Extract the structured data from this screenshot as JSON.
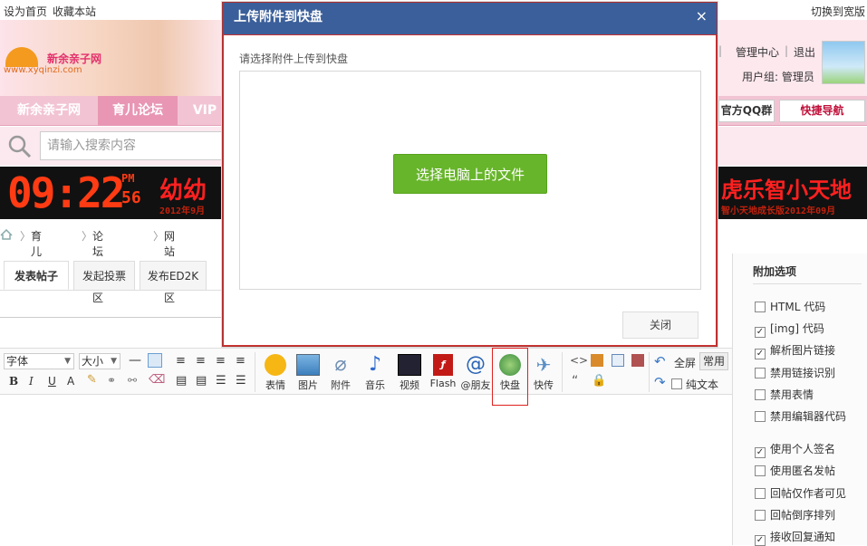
{
  "topbar": {
    "set_home": "设为首页",
    "bookmark": "收藏本站",
    "switch_wide": "切换到宽版"
  },
  "banner": {
    "logo_text": "新余亲子网",
    "logo_url": "www.xyqinzi.com",
    "admin_center": "管理中心",
    "logout": "退出",
    "sep": "|",
    "usergroup": "用户组: 管理员"
  },
  "nav": {
    "tabs": [
      "新余亲子网",
      "育儿论坛",
      "VIP"
    ],
    "qq_group": "官方QQ群",
    "quick_nav": "快捷导航"
  },
  "search": {
    "placeholder": "请输入搜索内容"
  },
  "led": {
    "time": "09:22",
    "ampm": "PM",
    "sec": "56",
    "left_text": "幼幼",
    "right_text": "虎乐智小天地",
    "left_sub": "2012年9月",
    "right_sub": "智小天地成长版2012年09月"
  },
  "breadcrumb": {
    "items": [
      "育儿论坛",
      "论坛讨论区",
      "网站管理区"
    ]
  },
  "post_tabs": [
    "发表帖子",
    "发起投票",
    "发布ED2K"
  ],
  "editor": {
    "font_select": "字体",
    "size_select": "大小",
    "tools": [
      {
        "icon": "smiley-icon",
        "label": "表情"
      },
      {
        "icon": "image-icon",
        "label": "图片"
      },
      {
        "icon": "attachment-icon",
        "label": "附件"
      },
      {
        "icon": "music-icon",
        "label": "音乐"
      },
      {
        "icon": "video-icon",
        "label": "视频"
      },
      {
        "icon": "flash-icon",
        "label": "Flash"
      },
      {
        "icon": "at-icon",
        "label": "@朋友"
      },
      {
        "icon": "kuaipan-icon",
        "label": "快盘"
      },
      {
        "icon": "kuaichuan-icon",
        "label": "快传"
      }
    ],
    "fullscreen": "全屏",
    "common": "常用",
    "plain_text": "纯文本"
  },
  "sidebar": {
    "title": "附加选项",
    "options": [
      {
        "label": "HTML 代码",
        "checked": false
      },
      {
        "label": "[img] 代码",
        "checked": true
      },
      {
        "label": "解析图片链接",
        "checked": true
      },
      {
        "label": "禁用链接识别",
        "checked": false
      },
      {
        "label": "禁用表情",
        "checked": false
      },
      {
        "label": "禁用编辑器代码",
        "checked": false
      },
      {
        "label": "使用个人签名",
        "checked": true
      },
      {
        "label": "使用匿名发帖",
        "checked": false
      },
      {
        "label": "回帖仅作者可见",
        "checked": false
      },
      {
        "label": "回帖倒序排列",
        "checked": false
      },
      {
        "label": "接收回复通知",
        "checked": true
      }
    ]
  },
  "dialog": {
    "title": "上传附件到快盘",
    "close_glyph": "×",
    "prompt": "请选择附件上传到快盘",
    "choose_button": "选择电脑上的文件",
    "close_button": "关闭"
  }
}
